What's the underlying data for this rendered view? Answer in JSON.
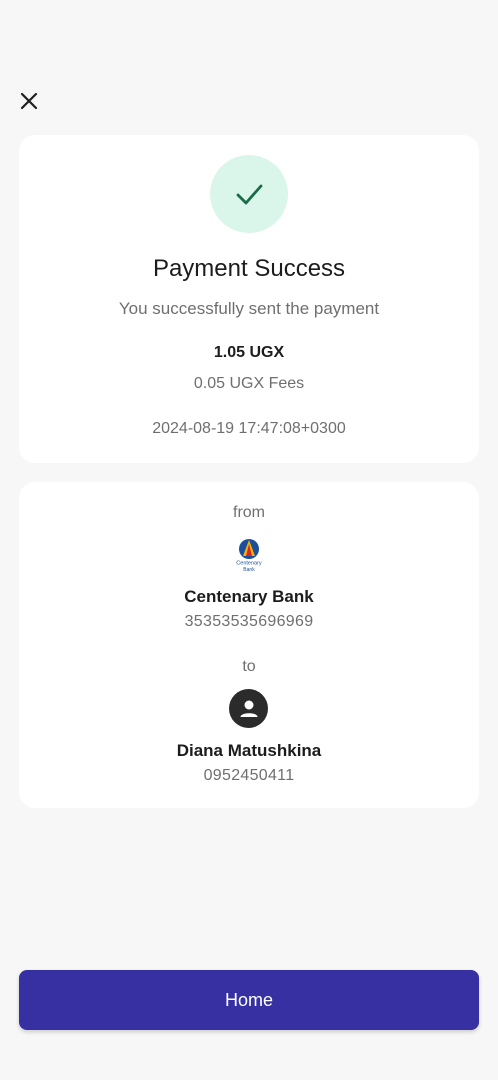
{
  "header": {
    "close_icon": "close-icon"
  },
  "success": {
    "icon": "check-icon",
    "title": "Payment Success",
    "subtitle": "You successfully sent the payment",
    "amount": "1.05 UGX",
    "fees": "0.05 UGX Fees",
    "datetime": "2024-08-19 17:47:08+0300",
    "accent_color": "#1a7a50",
    "badge_bg": "#daf5ea"
  },
  "transfer": {
    "from_label": "from",
    "bank": {
      "logo_icon": "centenary-bank-logo",
      "logo_text": "Centenary\nBank",
      "name": "Centenary Bank",
      "account": "35353535696969"
    },
    "to_label": "to",
    "recipient": {
      "avatar_icon": "person-icon",
      "name": "Diana Matushkina",
      "phone": "0952450411"
    }
  },
  "footer": {
    "home_label": "Home",
    "button_color": "#3730a3"
  }
}
